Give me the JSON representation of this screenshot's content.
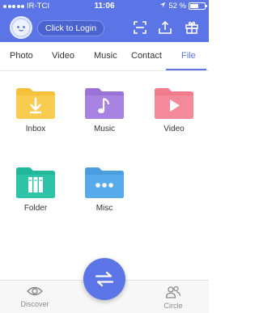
{
  "status": {
    "carrier": "IR-TCI",
    "time": "11:06",
    "battery": "52 %",
    "battery_level": 0.52
  },
  "header": {
    "login_label": "Click to Login",
    "icons": [
      "scan-icon",
      "upload-icon",
      "gift-icon"
    ]
  },
  "tabs": [
    {
      "label": "Photo",
      "active": false
    },
    {
      "label": "Video",
      "active": false
    },
    {
      "label": "Music",
      "active": false
    },
    {
      "label": "Contact",
      "active": false
    },
    {
      "label": "File",
      "active": true
    }
  ],
  "folders": [
    {
      "label": "Inbox",
      "color": "#f5c13a",
      "icon": "download-icon"
    },
    {
      "label": "Music",
      "color": "#9b73d6",
      "icon": "music-note-icon"
    },
    {
      "label": "Video",
      "color": "#f17c8c",
      "icon": "play-icon"
    },
    {
      "label": "Folder",
      "color": "#22b79b",
      "icon": "binders-icon"
    },
    {
      "label": "Misc",
      "color": "#4a9ee0",
      "icon": "more-dots-icon"
    }
  ],
  "bottom_nav": [
    {
      "label": "Discover",
      "icon": "eye-icon"
    },
    {
      "label": "Circle",
      "icon": "people-icon"
    }
  ],
  "colors": {
    "accent": "#5b75e6"
  }
}
